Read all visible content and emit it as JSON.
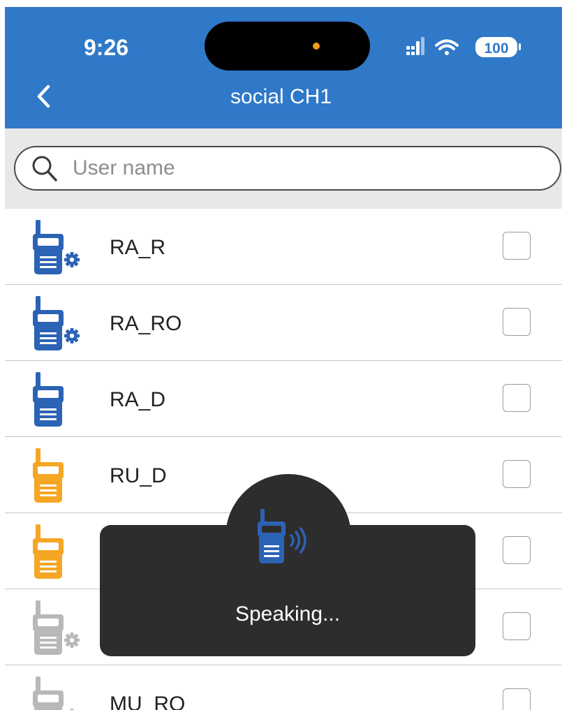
{
  "status_bar": {
    "time": "9:26",
    "battery": "100",
    "icons": [
      "cellular-signal-icon",
      "wifi-icon",
      "battery-icon"
    ]
  },
  "header": {
    "title": "social CH1",
    "back_icon": "chevron-left-icon"
  },
  "search": {
    "placeholder": "User name",
    "value": ""
  },
  "users": [
    {
      "name": "RA_R",
      "icon": "radio-settings-icon",
      "color": "#2b63b5",
      "checked": false
    },
    {
      "name": "RA_RO",
      "icon": "radio-settings-icon",
      "color": "#2b63b5",
      "checked": false
    },
    {
      "name": "RA_D",
      "icon": "radio-icon",
      "color": "#2b63b5",
      "checked": false
    },
    {
      "name": "RU_D",
      "icon": "radio-icon",
      "color": "#f5a623",
      "checked": false
    },
    {
      "name": "",
      "icon": "radio-icon",
      "color": "#f5a623",
      "checked": false
    },
    {
      "name": "",
      "icon": "radio-settings-icon",
      "color": "#b8b8b8",
      "checked": false
    },
    {
      "name": "MU_RO",
      "icon": "radio-settings-icon",
      "color": "#b8b8b8",
      "checked": false
    }
  ],
  "toast": {
    "text": "Speaking...",
    "icon": "radio-speaking-icon"
  },
  "colors": {
    "header_bg": "#2f79c8",
    "blue_radio": "#2b63b5",
    "orange_radio": "#f5a623",
    "gray_radio": "#b8b8b8",
    "toast_bg": "#2d2d2d",
    "camera_dot": "#f59a23"
  }
}
